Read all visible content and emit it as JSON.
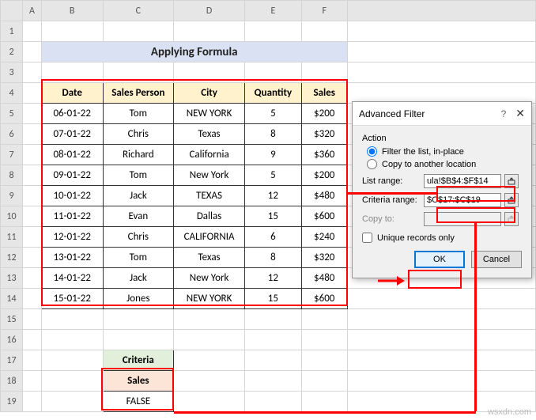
{
  "title": "Applying Formula",
  "columns": [
    "A",
    "B",
    "C",
    "D",
    "E",
    "F"
  ],
  "rows": [
    "1",
    "2",
    "3",
    "4",
    "5",
    "6",
    "7",
    "8",
    "9",
    "10",
    "11",
    "12",
    "13",
    "14",
    "15",
    "16",
    "17",
    "18",
    "19"
  ],
  "table": {
    "headers": [
      "Date",
      "Sales Person",
      "City",
      "Quantity",
      "Sales"
    ],
    "data": [
      [
        "06-01-22",
        "Tom",
        "NEW YORK",
        "5",
        "$200"
      ],
      [
        "07-01-22",
        "Chris",
        "Texas",
        "8",
        "$320"
      ],
      [
        "08-01-22",
        "Richard",
        "California",
        "9",
        "$360"
      ],
      [
        "09-01-22",
        "Tom",
        "New York",
        "5",
        "$200"
      ],
      [
        "10-01-22",
        "Jack",
        "TEXAS",
        "12",
        "$480"
      ],
      [
        "11-01-22",
        "Evan",
        "Dallas",
        "15",
        "$600"
      ],
      [
        "12-01-22",
        "Chris",
        "CALIFORNIA",
        "6",
        "$240"
      ],
      [
        "13-01-22",
        "Tom",
        "Texas",
        "8",
        "$320"
      ],
      [
        "14-01-22",
        "Jack",
        "New York",
        "12",
        "$480"
      ],
      [
        "15-01-22",
        "Jones",
        "NEW YORK",
        "15",
        "$600"
      ]
    ]
  },
  "criteria": {
    "title": "Criteria",
    "header": "Sales",
    "value": "FALSE"
  },
  "dialog": {
    "title": "Advanced Filter",
    "help": "?",
    "close": "✕",
    "action_label": "Action",
    "radio1": "Filter the list, in-place",
    "radio2": "Copy to another location",
    "list_range_label": "List range:",
    "list_range_value": "ula!$B$4:$F$14",
    "criteria_range_label": "Criteria range:",
    "criteria_range_value": "$C$17:$C$19",
    "copy_to_label": "Copy to:",
    "copy_to_value": "",
    "unique_label": "Unique records only",
    "ok": "OK",
    "cancel": "Cancel"
  },
  "chart_data": {
    "type": "table",
    "title": "Applying Formula",
    "headers": [
      "Date",
      "Sales Person",
      "City",
      "Quantity",
      "Sales"
    ],
    "rows": [
      {
        "Date": "06-01-22",
        "Sales Person": "Tom",
        "City": "NEW YORK",
        "Quantity": 5,
        "Sales": 200
      },
      {
        "Date": "07-01-22",
        "Sales Person": "Chris",
        "City": "Texas",
        "Quantity": 8,
        "Sales": 320
      },
      {
        "Date": "08-01-22",
        "Sales Person": "Richard",
        "City": "California",
        "Quantity": 9,
        "Sales": 360
      },
      {
        "Date": "09-01-22",
        "Sales Person": "Tom",
        "City": "New York",
        "Quantity": 5,
        "Sales": 200
      },
      {
        "Date": "10-01-22",
        "Sales Person": "Jack",
        "City": "TEXAS",
        "Quantity": 12,
        "Sales": 480
      },
      {
        "Date": "11-01-22",
        "Sales Person": "Evan",
        "City": "Dallas",
        "Quantity": 15,
        "Sales": 600
      },
      {
        "Date": "12-01-22",
        "Sales Person": "Chris",
        "City": "CALIFORNIA",
        "Quantity": 6,
        "Sales": 240
      },
      {
        "Date": "13-01-22",
        "Sales Person": "Tom",
        "City": "Texas",
        "Quantity": 8,
        "Sales": 320
      },
      {
        "Date": "14-01-22",
        "Sales Person": "Jack",
        "City": "New York",
        "Quantity": 12,
        "Sales": 480
      },
      {
        "Date": "15-01-22",
        "Sales Person": "Jones",
        "City": "NEW YORK",
        "Quantity": 15,
        "Sales": 600
      }
    ]
  },
  "watermark": "wsxdn.com"
}
